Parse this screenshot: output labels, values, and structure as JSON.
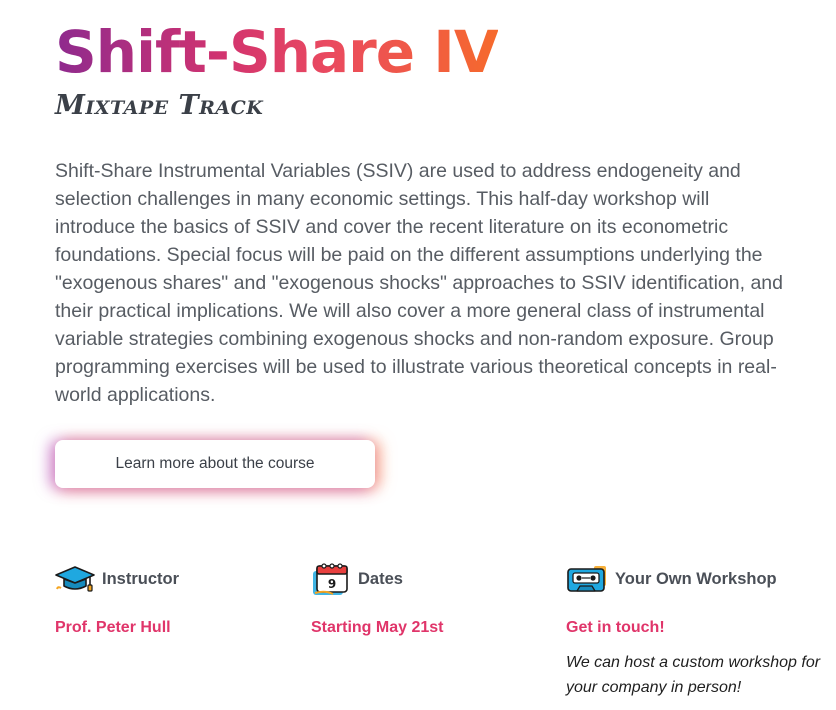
{
  "header": {
    "title": "Shift-Share IV",
    "subtitle": "Mixtape Track"
  },
  "main": {
    "description": "Shift-Share Instrumental Variables (SSIV) are used to address endogeneity and selection challenges in many economic settings. This half-day workshop will introduce the basics of SSIV and cover the recent literature on its econometric foundations. Special focus will be paid on the different assumptions underlying the \"exogenous shares\" and \"exogenous shocks\" approaches to SSIV identification, and their practical implications. We will also cover a more general class of instrumental variable strategies combining exogenous shocks and non-random exposure. Group programming exercises will be used to illustrate various theoretical concepts in real-world applications.",
    "cta_label": "Learn more about the course"
  },
  "info": {
    "instructor": {
      "title": "Instructor",
      "value": "Prof. Peter Hull",
      "icon": "graduation-cap-icon"
    },
    "dates": {
      "title": "Dates",
      "value": "Starting May 21st",
      "icon": "calendar-icon",
      "calendar_day": "9"
    },
    "workshop": {
      "title": "Your Own Workshop",
      "value": "Get in touch!",
      "note": "We can host a custom workshop for your company in person!",
      "icon": "cassette-icon"
    }
  },
  "colors": {
    "accent": "#e0356a",
    "title_gradient": [
      "#8e2a8e",
      "#d2336f",
      "#ea4a5f",
      "#f66a2c"
    ]
  }
}
